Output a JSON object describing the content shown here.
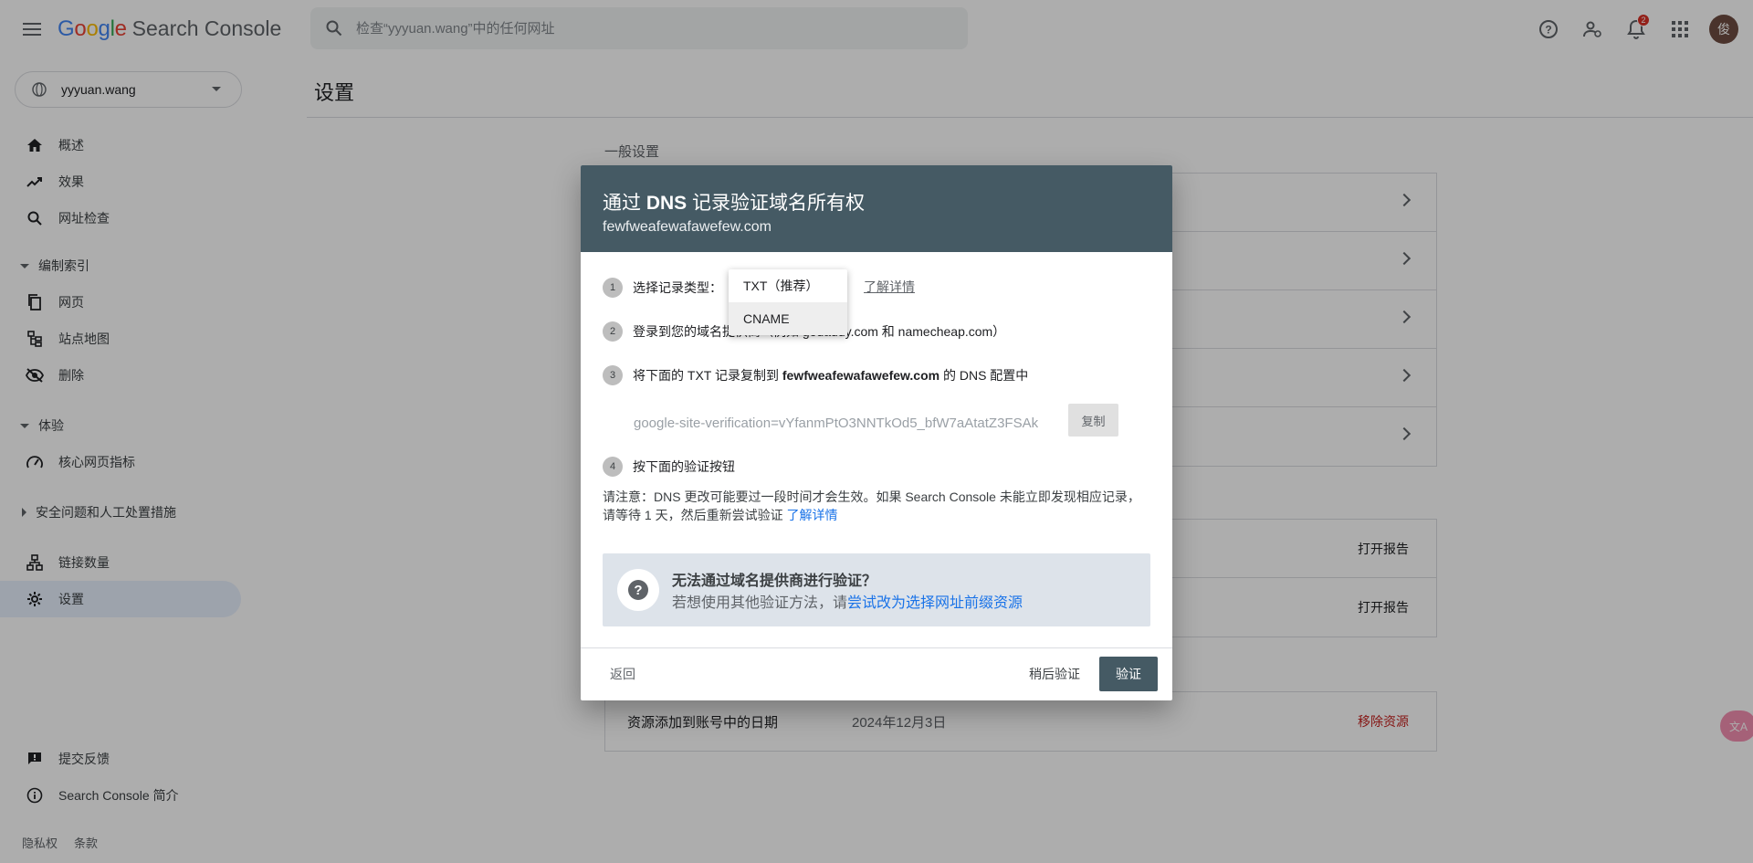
{
  "header": {
    "logo_google": "Google",
    "logo_product": "Search Console",
    "search_placeholder": "检查“yyyuan.wang”中的任何网址",
    "notification_count": "2",
    "avatar_letter": "俊"
  },
  "sidebar": {
    "property_name": "yyyuan.wang",
    "items": {
      "overview": "概述",
      "performance": "效果",
      "url_inspection": "网址检查",
      "indexing_section": "编制索引",
      "pages": "网页",
      "sitemaps": "站点地图",
      "removals": "删除",
      "experience_section": "体验",
      "core_web_vitals": "核心网页指标",
      "security_section": "安全问题和人工处置措施",
      "links": "链接数量",
      "settings": "设置",
      "feedback": "提交反馈",
      "about": "Search Console 简介"
    },
    "footer": {
      "privacy": "隐私权",
      "terms": "条款"
    }
  },
  "main": {
    "page_title": "设置",
    "general_settings_label": "一般设置",
    "open_report": "打开报告",
    "date_added_label": "资源添加到账号中的日期",
    "date_added_value": "2024年12月3日",
    "remove_property": "移除资源"
  },
  "dialog": {
    "title_prefix": "通过 ",
    "title_bold": "DNS",
    "title_suffix": " 记录验证域名所有权",
    "subtitle": "fewfweafewafawefew.com",
    "step1_label": "选择记录类型：",
    "step1_learn_more": "了解详情",
    "step2_text": "登录到您的域名提供商（例如 godaddy.com 和 namecheap.com）",
    "step3_prefix": "将下面的 TXT 记录复制到 ",
    "step3_domain": "fewfweafewafawefew.com",
    "step3_suffix": " 的 DNS 配置中",
    "record_value": "google-site-verification=vYfanmPtO3NNTkOd5_bfW7aAtatZ3FSAk",
    "copy_button": "复制",
    "step4_text": "按下面的验证按钮",
    "note_text": "请注意：DNS 更改可能要过一段时间才会生效。如果 Search Console 未能立即发现相应记录，请等待 1 天，然后重新尝试验证 ",
    "note_link": "了解详情",
    "help_title": "无法通过域名提供商进行验证？",
    "help_prefix": "若想使用其他验证方法，请",
    "help_link": "尝试改为选择网址前缀资源",
    "back_button": "返回",
    "later_button": "稍后验证",
    "verify_button": "验证",
    "step_numbers": [
      "1",
      "2",
      "3",
      "4"
    ],
    "dropdown_options": [
      "TXT（推荐）",
      "CNAME"
    ]
  },
  "colors": {
    "dialog_header": "#455a64",
    "link_blue": "#1a73e8",
    "remove_red": "#c5221f",
    "active_nav": "#e8f0fe"
  },
  "fab_label": "文A"
}
